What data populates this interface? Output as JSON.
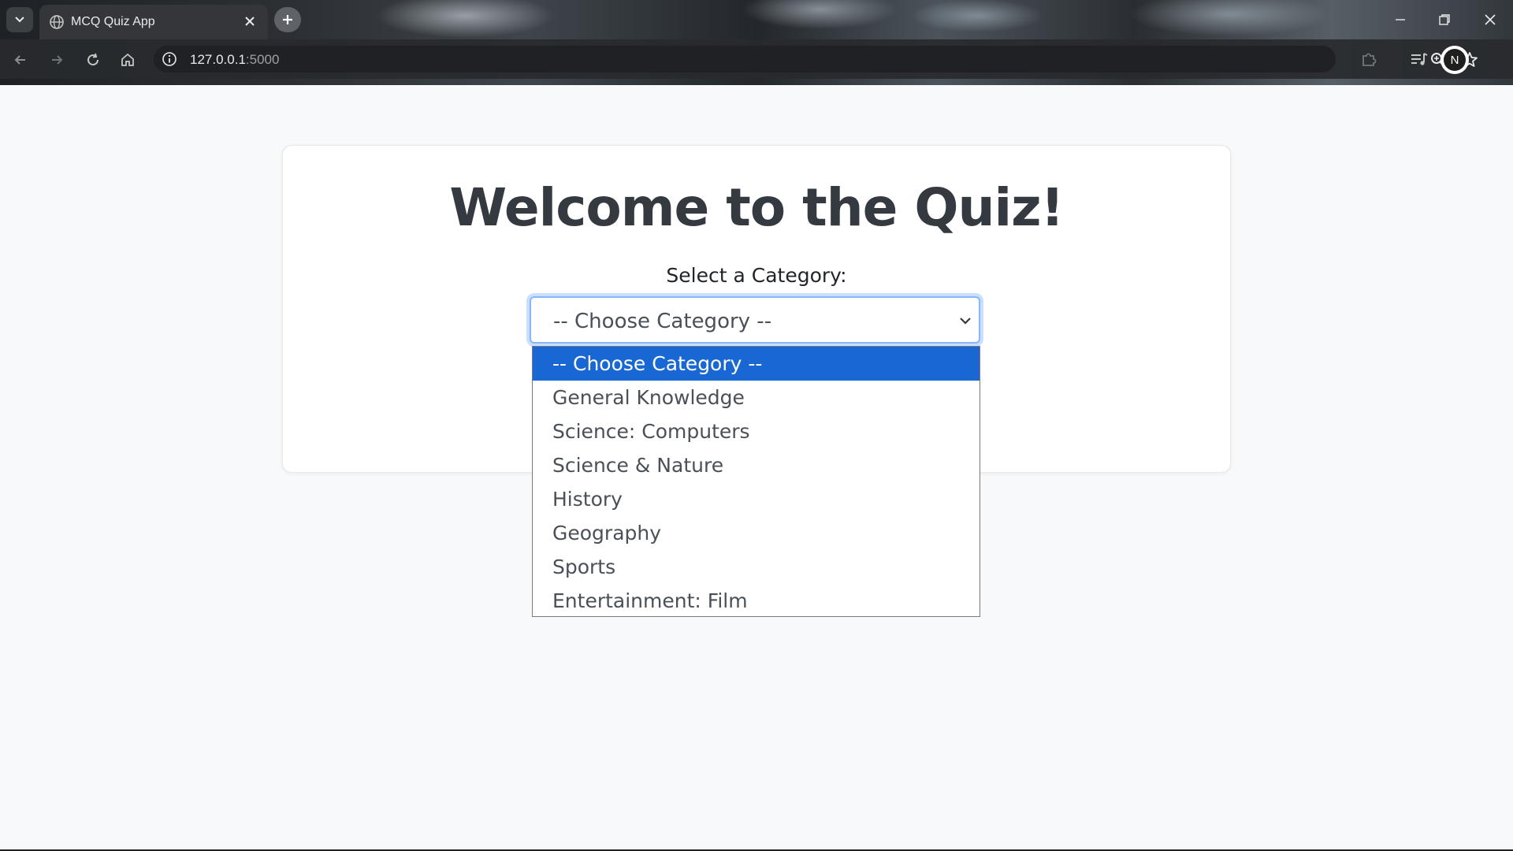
{
  "browser": {
    "tab": {
      "title": "MCQ Quiz App"
    },
    "address": {
      "host": "127.0.0.1",
      "port": ":5000"
    },
    "profile_initial": "N"
  },
  "page": {
    "title": "Welcome to the Quiz!",
    "category_label": "Select a Category:",
    "category_select": {
      "selected_value": "-- Choose Category --",
      "options": [
        "-- Choose Category --",
        "General Knowledge",
        "Science: Computers",
        "Science & Nature",
        "History",
        "Geography",
        "Sports",
        "Entertainment: Film"
      ]
    }
  },
  "icons": {
    "tab_search": "chevron-down-icon",
    "favicon": "globe-icon",
    "new_tab": "plus-icon",
    "back": "arrow-left-icon",
    "forward": "arrow-right-icon",
    "reload": "reload-icon",
    "home": "home-icon",
    "site_info": "info-icon",
    "zoom": "zoom-icon",
    "bookmark": "star-icon",
    "extensions": "puzzle-icon",
    "media": "media-control-icon"
  },
  "colors": {
    "option_highlight": "#1967d2",
    "focus_ring": "#86b7fe",
    "page_background": "#f8f9fa"
  }
}
